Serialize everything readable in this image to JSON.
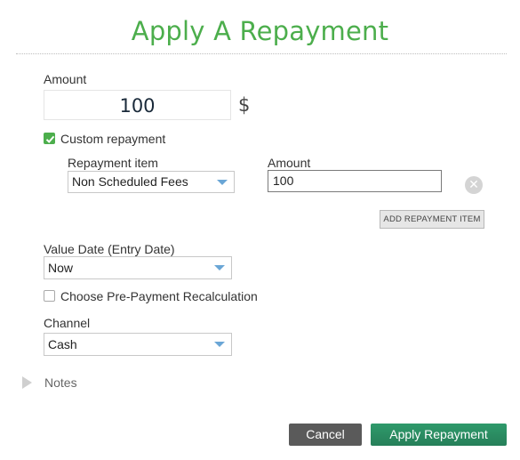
{
  "dialog": {
    "title": "Apply A Repayment"
  },
  "amount": {
    "label": "Amount",
    "value": "100",
    "currency": "$"
  },
  "custom_repayment": {
    "label": "Custom repayment",
    "checked": true
  },
  "repayment_items": {
    "item_label": "Repayment item",
    "amount_label": "Amount",
    "rows": [
      {
        "item": "Non Scheduled Fees",
        "amount": "100"
      }
    ],
    "add_button_label": "ADD REPAYMENT ITEM"
  },
  "value_date": {
    "label": "Value Date (Entry Date)",
    "selected": "Now"
  },
  "prepayment_recalc": {
    "label": "Choose Pre-Payment Recalculation",
    "checked": false
  },
  "channel": {
    "label": "Channel",
    "selected": "Cash"
  },
  "notes": {
    "label": "Notes"
  },
  "footer": {
    "cancel_label": "Cancel",
    "apply_label": "Apply Repayment"
  },
  "colors": {
    "title": "#4cae4c",
    "checkbox_checked": "#4cae4c",
    "apply_button": "#2d8f64",
    "cancel_button": "#5a5a5a",
    "caret": "#6aa6d6"
  },
  "icons": [
    "checkmark-icon",
    "remove-circle-icon",
    "dropdown-caret-icon",
    "expand-triangle-icon"
  ]
}
